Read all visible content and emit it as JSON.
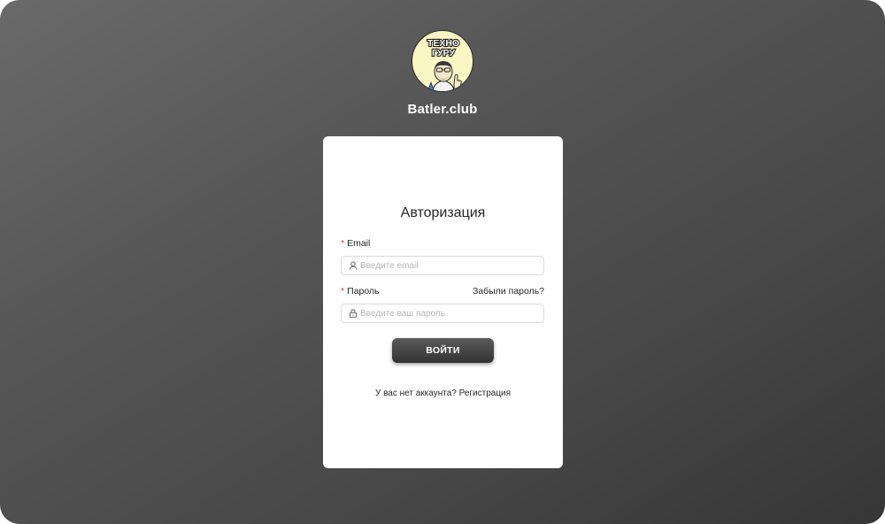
{
  "brand": {
    "logo_line1": "ТЕХНО",
    "logo_line2": "ГУРУ",
    "name": "Batler.club"
  },
  "login": {
    "title": "Авторизация",
    "email_required_mark": "*",
    "email_label": "Email",
    "email_placeholder": "Введите email",
    "email_value": "",
    "email_icon": "user-icon",
    "password_required_mark": "*",
    "password_label": "Пароль",
    "forgot_link": "Забыли пароль?",
    "password_placeholder": "Введите ваш пароль",
    "password_value": "",
    "password_icon": "lock-icon",
    "submit_label": "ВОЙТИ",
    "no_account_text": "У вас нет аккаунта?",
    "register_link": "Регистрация"
  },
  "colors": {
    "background_start": "#6a6a6a",
    "background_end": "#363636",
    "card": "#ffffff",
    "logo_bg": "#fbf7c2",
    "required_mark": "#e53935",
    "button": "#3f3f3f"
  }
}
